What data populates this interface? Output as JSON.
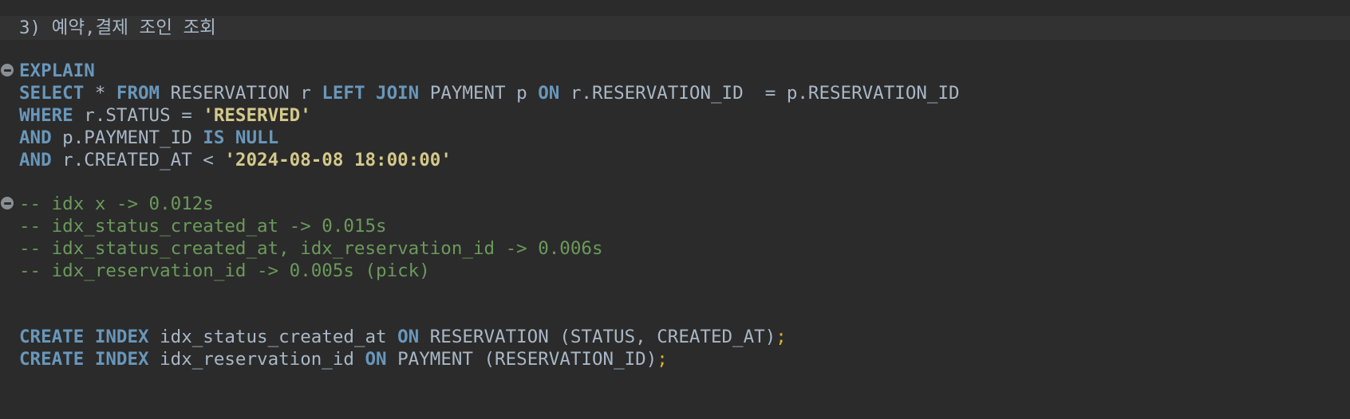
{
  "editor": {
    "lines": {
      "header": "3) 예약,결제 조인 조회",
      "explain": "EXPLAIN",
      "select": {
        "kw_select": "SELECT",
        "star": " * ",
        "kw_from": "FROM",
        "t1": " RESERVATION r ",
        "kw_left_join": "LEFT JOIN",
        "t2": " PAYMENT p ",
        "kw_on": "ON",
        "cond": " r.RESERVATION_ID  = p.RESERVATION_ID"
      },
      "where": {
        "kw_where": "WHERE",
        "lhs": " r.STATUS = ",
        "value": "'RESERVED'"
      },
      "and1": {
        "kw_and": "AND",
        "lhs": " p.PAYMENT_ID ",
        "kw_is_null": "IS NULL"
      },
      "and2": {
        "kw_and": "AND",
        "lhs": " r.CREATED_AT < ",
        "value": "'2024-08-08 18:00:00'"
      },
      "comments": [
        "-- idx x -> 0.012s",
        "-- idx_status_created_at -> 0.015s",
        "-- idx_status_created_at, idx_reservation_id -> 0.006s",
        "-- idx_reservation_id -> 0.005s (pick)"
      ],
      "create1": {
        "kw_create_index": "CREATE INDEX",
        "name": " idx_status_created_at ",
        "kw_on": "ON",
        "rest": " RESERVATION (STATUS, CREATED_AT)",
        "semi": ";"
      },
      "create2": {
        "kw_create_index": "CREATE INDEX",
        "name": " idx_reservation_id ",
        "kw_on": "ON",
        "rest": " PAYMENT (RESERVATION_ID)",
        "semi": ";"
      }
    }
  },
  "icons": {
    "fold": "fold-collapse-icon"
  },
  "colors": {
    "background": "#2b2b2b",
    "keyword": "#6897bb",
    "string": "#d4c98a",
    "comment": "#6a9a5a",
    "identifier": "#a9b7c6",
    "semicolon": "#e0b030"
  }
}
